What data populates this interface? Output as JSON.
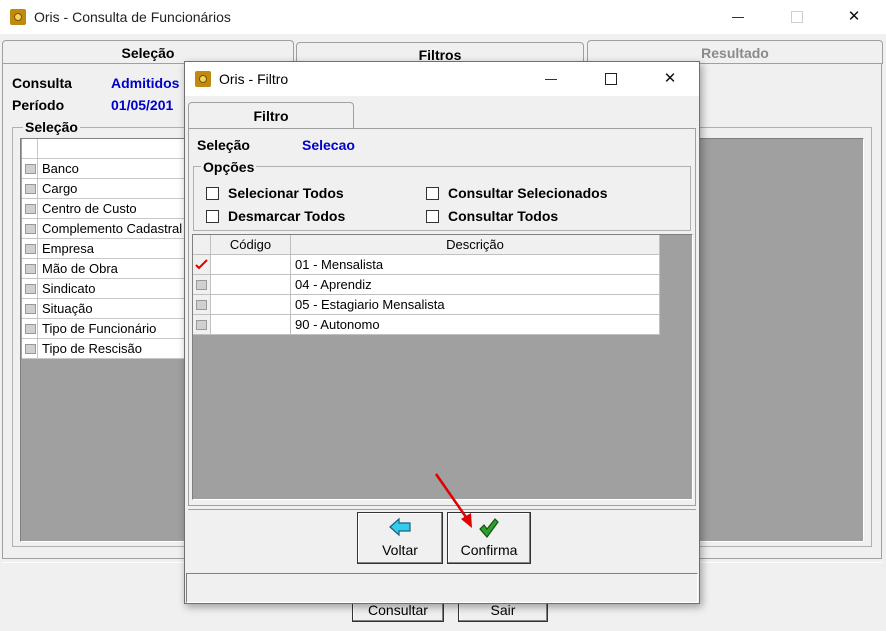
{
  "main_window": {
    "title": "Oris - Consulta de Funcionários",
    "tabs": [
      "Seleção",
      "Filtros",
      "Resultado"
    ],
    "consulta_label": "Consulta",
    "consulta_value": "Admitidos",
    "periodo_label": "Período",
    "periodo_value": "01/05/201",
    "selecao_group_label": "Seleção",
    "selecao_items": [
      "Banco",
      "Cargo",
      "Centro de Custo",
      "Complemento Cadastral",
      "Empresa",
      "Mão de Obra",
      "Sindicato",
      "Situação",
      "Tipo de Funcionário",
      "Tipo de Rescisão"
    ],
    "buttons": {
      "consultar": "Consultar",
      "sair": "Sair"
    }
  },
  "dialog": {
    "title": "Oris - Filtro",
    "tab": "Filtro",
    "selecao_label": "Seleção",
    "selecao_value": "Selecao",
    "opcoes_label": "Opções",
    "options": {
      "selecionar_todos": "Selecionar Todos",
      "desmarcar_todos": "Desmarcar Todos",
      "consultar_selecionados": "Consultar Selecionados",
      "consultar_todos": "Consultar Todos"
    },
    "grid": {
      "headers": [
        "Código",
        "Descrição"
      ],
      "rows": [
        {
          "codigo": "",
          "descricao": "01 - Mensalista",
          "checked": true
        },
        {
          "codigo": "",
          "descricao": "04 - Aprendiz",
          "checked": false
        },
        {
          "codigo": "",
          "descricao": "05 - Estagiario Mensalista",
          "checked": false
        },
        {
          "codigo": "",
          "descricao": "90 - Autonomo",
          "checked": false
        }
      ]
    },
    "buttons": {
      "voltar": "Voltar",
      "confirma": "Confirma"
    }
  },
  "colors": {
    "accent_blue": "#0000cc",
    "check_red": "#e00000",
    "confirm_green": "#2ca02c",
    "back_cyan": "#33ccee",
    "arrow_red": "#e00000"
  }
}
